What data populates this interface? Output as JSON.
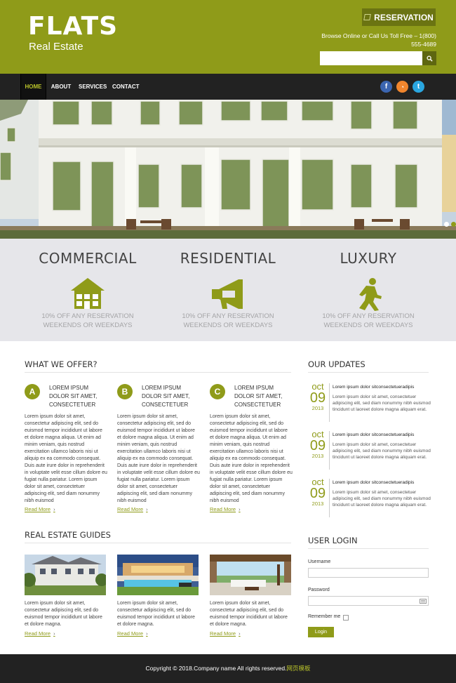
{
  "header": {
    "logo_title": "FLATS",
    "logo_subtitle": "Real Estate",
    "reservation_label": "RESERVATION",
    "tollfree_text": "Browse Online or Call Us Toll Free – 1(800) 555-4689",
    "search_placeholder": "",
    "accent_color": "#8f9b19"
  },
  "nav": {
    "items": [
      {
        "label": "HOME",
        "active": true
      },
      {
        "label": "ABOUT",
        "active": false
      },
      {
        "label": "SERVICES",
        "active": false
      },
      {
        "label": "CONTACT",
        "active": false
      }
    ],
    "social": [
      {
        "icon": "facebook-icon",
        "glyph": "f",
        "color": "#3b65b0"
      },
      {
        "icon": "rss-icon",
        "glyph": "◔",
        "color": "#f0852d"
      },
      {
        "icon": "twitter-icon",
        "glyph": "t",
        "color": "#2aa6e0"
      }
    ]
  },
  "hero": {
    "slider_dots": 2,
    "active_dot": 0
  },
  "features": [
    {
      "title": "COMMERCIAL",
      "icon": "house-icon",
      "text_line1": "10% OFF ANY RESERVATION",
      "text_line2": "WEEKENDS OR WEEKDAYS"
    },
    {
      "title": "RESIDENTIAL",
      "icon": "megaphone-icon",
      "text_line1": "10% OFF ANY RESERVATION",
      "text_line2": "WEEKENDS OR WEEKDAYS"
    },
    {
      "title": "LUXURY",
      "icon": "walking-man-icon",
      "text_line1": "10% OFF ANY RESERVATION",
      "text_line2": "WEEKENDS OR WEEKDAYS"
    }
  ],
  "offer": {
    "title": "WHAT WE OFFER?",
    "items": [
      {
        "badge": "A",
        "heading": "LOREM IPSUM DOLOR SIT AMET, CONSECTETUER",
        "body": "Lorem ipsum dolor sit amet, consectetur adipiscing elit, sed do euismod tempor incididunt ut labore et dolore magna aliqua. Ut enim ad minim veniam, quis nostrud exercitation ullamco laboris nisi ut aliquip ex ea commodo consequat. Duis aute irure dolor in reprehenderit in voluptate velit esse cillum dolore eu fugiat nulla pariatur. Lorem ipsum dolor sit amet, consectetuer adipiscing elit, sed diam nonummy nibh euismod",
        "read_more": "Read More"
      },
      {
        "badge": "B",
        "heading": "LOREM IPSUM DOLOR SIT AMET, CONSECTETUER",
        "body": "Lorem ipsum dolor sit amet, consectetur adipiscing elit, sed do euismod tempor incididunt ut labore et dolore magna aliqua. Ut enim ad minim veniam, quis nostrud exercitation ullamco laboris nisi ut aliquip ex ea commodo consequat. Duis aute irure dolor in reprehenderit in voluptate velit esse cillum dolore eu fugiat nulla pariatur. Lorem ipsum dolor sit amet, consectetuer adipiscing elit, sed diam nonummy nibh euismod",
        "read_more": "Read More"
      },
      {
        "badge": "C",
        "heading": "LOREM IPSUM DOLOR SIT AMET, CONSECTETUER",
        "body": "Lorem ipsum dolor sit amet, consectetur adipiscing elit, sed do euismod tempor incididunt ut labore et dolore magna aliqua. Ut enim ad minim veniam, quis nostrud exercitation ullamco laboris nisi ut aliquip ex ea commodo consequat. Duis aute irure dolor in reprehenderit in voluptate velit esse cillum dolore eu fugiat nulla pariatur. Lorem ipsum dolor sit amet, consectetuer adipiscing elit, sed diam nonummy nibh euismod",
        "read_more": "Read More"
      }
    ]
  },
  "updates": {
    "title": "OUR UPDATES",
    "items": [
      {
        "month": "oct",
        "day": "09",
        "year": "2013",
        "heading": "Lorem ipsum dolor sitconsectetueradipis",
        "body": "Lorem ipsum dolor sit amet, consectetuer adipiscing elit, sed diam nonummy nibh euismod tincidunt ut laoreet dolore magna aliquam erat."
      },
      {
        "month": "oct",
        "day": "09",
        "year": "2013",
        "heading": "Lorem ipsum dolor sitconsectetueradipis",
        "body": "Lorem ipsum dolor sit amet, consectetuer adipiscing elit, sed diam nonummy nibh euismod tincidunt ut laoreet dolore magna aliquam erat."
      },
      {
        "month": "oct",
        "day": "09",
        "year": "2013",
        "heading": "Lorem ipsum dolor sitconsectetueradipis",
        "body": "Lorem ipsum dolor sit amet, consectetuer adipiscing elit, sed diam nonummy nibh euismod tincidunt ut laoreet dolore magna aliquam erat."
      }
    ]
  },
  "guides": {
    "title": "REAL ESTATE GUIDES",
    "items": [
      {
        "image": "townhouse-photo",
        "body": "Lorem ipsum dolor sit amet, consectetur adipiscing elit, sed do euismod tempor incididunt ut labore et dolore magna.",
        "read_more": "Read More"
      },
      {
        "image": "pool-house-photo",
        "body": "Lorem ipsum dolor sit amet, consectetur adipiscing elit, sed do euismod tempor incididunt ut labore et dolore magna.",
        "read_more": "Read More"
      },
      {
        "image": "living-room-photo",
        "body": "Lorem ipsum dolor sit amet, consectetur adipiscing elit, sed do euismod tempor incididunt ut labore et dolore magna.",
        "read_more": "Read More"
      }
    ]
  },
  "login": {
    "title": "USER LOGIN",
    "username_label": "Username",
    "username_value": "",
    "password_label": "Password",
    "password_value": "",
    "remember_label": "Remember me",
    "remember_checked": false,
    "button_label": "Login"
  },
  "footer": {
    "copyright": "Copyright © 2018.Company name All rights reserved.",
    "link_text": "网页模板"
  }
}
